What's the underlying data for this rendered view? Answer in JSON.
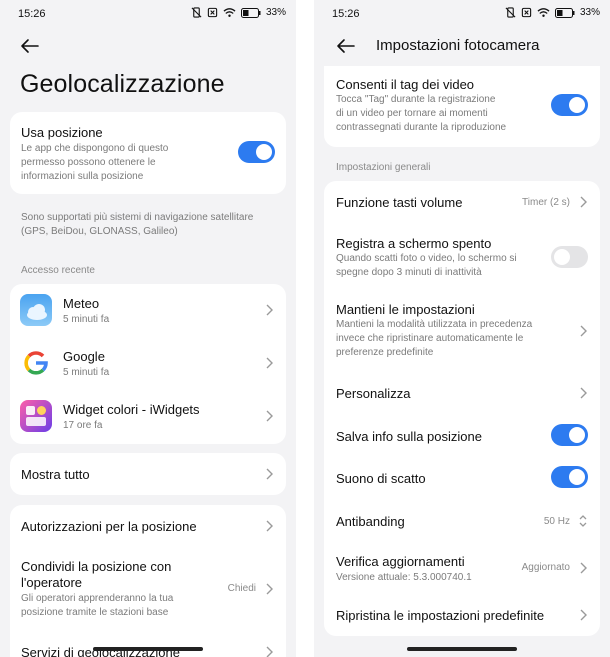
{
  "left": {
    "status": {
      "time": "15:26",
      "battery": "33"
    },
    "title": "Geolocalizzazione",
    "use_location": {
      "title": "Usa posizione",
      "subtitle_lines": [
        "Le app che dispongono di questo",
        "permesso possono ottenere le",
        "informazioni sulla posizione"
      ],
      "enabled": true
    },
    "satellite_note_lines": [
      "Sono supportati più sistemi di navigazione satellitare",
      "(GPS, BeiDou, GLONASS, Galileo)"
    ],
    "recent_header": "Accesso recente",
    "recent_apps": [
      {
        "name": "Meteo",
        "time": "5 minuti fa",
        "icon": "weather-icon"
      },
      {
        "name": "Google",
        "time": "5 minuti fa",
        "icon": "google-icon"
      },
      {
        "name": "Widget colori - iWidgets",
        "time": "17 ore fa",
        "icon": "iwidgets-icon"
      }
    ],
    "show_all": "Mostra tutto",
    "permissions": "Autorizzazioni per la posizione",
    "share_operator": {
      "title_lines": [
        "Condividi la posizione con",
        "l'operatore"
      ],
      "subtitle_lines": [
        "Gli operatori apprenderanno la tua",
        "posizione tramite le stazioni base"
      ],
      "value": "Chiedi"
    },
    "geo_services": "Servizi di geolocalizzazione"
  },
  "right": {
    "status": {
      "time": "15:26",
      "battery": "33"
    },
    "header_title": "Impostazioni fotocamera",
    "video_tag": {
      "title": "Consenti il tag dei video",
      "subtitle_lines": [
        "Tocca \"Tag\" durante la registrazione",
        "di un video per tornare ai momenti",
        "contrassegnati durante la riproduzione"
      ],
      "enabled": true
    },
    "general_header": "Impostazioni generali",
    "volume_keys": {
      "title": "Funzione tasti volume",
      "value": "Timer (2 s)"
    },
    "record_screen_off": {
      "title": "Registra a schermo spento",
      "subtitle_lines": [
        "Quando scatti foto o video, lo schermo si",
        "spegne dopo 3 minuti di inattività"
      ],
      "enabled": false
    },
    "keep_settings": {
      "title": "Mantieni le impostazioni",
      "subtitle_lines": [
        "Mantieni la modalità utilizzata in precedenza",
        "invece che ripristinare automaticamente le",
        "preferenze predefinite"
      ]
    },
    "customize": "Personalizza",
    "save_location": {
      "title": "Salva info sulla posizione",
      "enabled": true
    },
    "shutter_sound": {
      "title": "Suono di scatto",
      "enabled": true
    },
    "antibanding": {
      "title": "Antibanding",
      "value": "50 Hz"
    },
    "check_updates": {
      "title": "Verifica aggiornamenti",
      "subtitle": "Versione attuale: 5.3.000740.1",
      "value": "Aggiornato"
    },
    "restore_defaults": "Ripristina le impostazioni predefinite"
  },
  "colors": {
    "accent": "#2d7bf0",
    "background": "#f3f3f5",
    "card": "#ffffff"
  }
}
